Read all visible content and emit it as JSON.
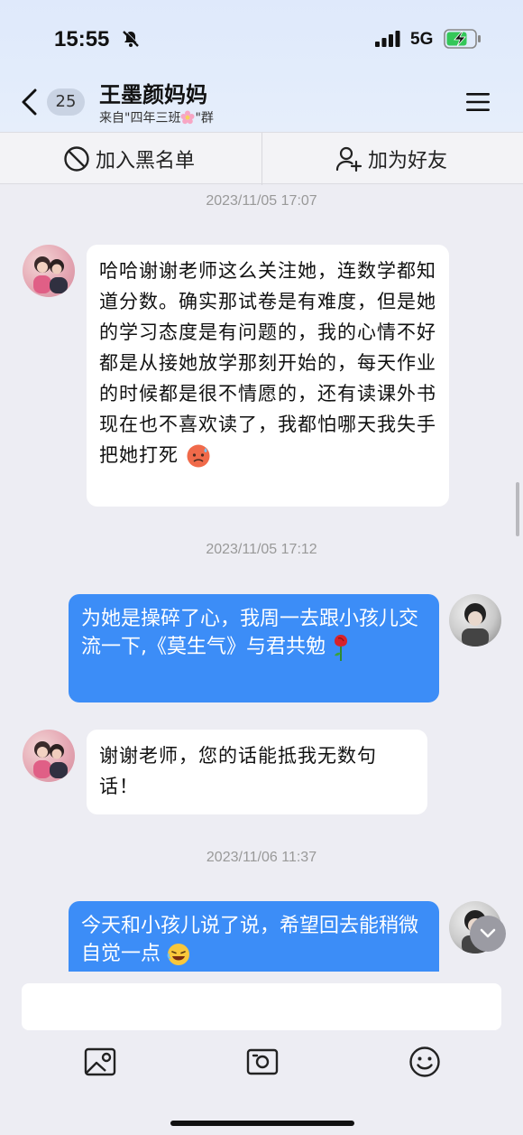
{
  "status_bar": {
    "time": "15:55",
    "network": "5G",
    "icons": [
      "bell-off-icon",
      "signal-icon",
      "battery-charging-icon"
    ]
  },
  "header": {
    "unread_count": "25",
    "contact_name": "王墨颜妈妈",
    "source_prefix": "来自\"四年三班",
    "source_suffix": "\"群",
    "icons": [
      "back-icon",
      "menu-icon",
      "flower-icon"
    ]
  },
  "actions": {
    "block_label": "加入黑名单",
    "add_friend_label": "加为好友",
    "icons": [
      "block-icon",
      "add-user-icon"
    ]
  },
  "messages": [
    {
      "type": "time",
      "text": "2023/11/05 17:07"
    },
    {
      "type": "in",
      "text": "哈哈谢谢老师这么关注她，连数学都知道分数。确实那试卷是有难度，但是她的学习态度是有问题的，我的心情不好都是从接她放学那刻开始的，每天作业的时候都是很不情愿的，还有读课外书现在也不喜欢读了，我都怕哪天我失手把她打死",
      "emoji": "sweating-face-emoji"
    },
    {
      "type": "time",
      "text": "2023/11/05 17:12"
    },
    {
      "type": "out",
      "text": "为她是操碎了心，我周一去跟小孩儿交流一下,《莫生气》与君共勉",
      "emoji": "rose-emoji"
    },
    {
      "type": "in",
      "text": "谢谢老师，您的话能抵我无数句话！"
    },
    {
      "type": "time",
      "text": "2023/11/06 11:37"
    },
    {
      "type": "out",
      "text": "今天和小孩儿说了说，希望回去能稍微自觉一点",
      "emoji": "laughing-face-emoji"
    }
  ],
  "colors": {
    "header_bg": "#e2ecfb",
    "chat_bg": "#ededf3",
    "outgoing_bubble": "#3c8df7",
    "incoming_bubble": "#ffffff"
  },
  "input": {
    "value": "",
    "tool_icons": [
      "image-icon",
      "camera-icon",
      "emoji-icon"
    ]
  }
}
